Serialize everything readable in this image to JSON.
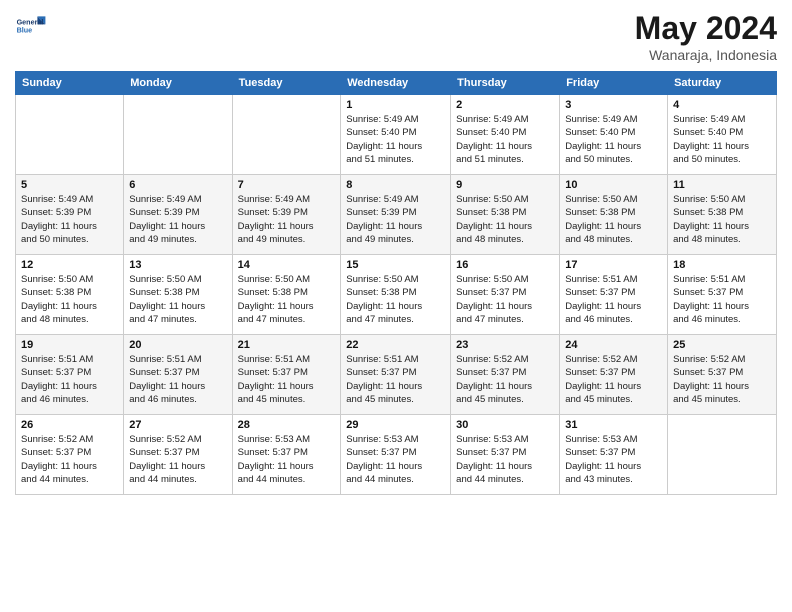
{
  "header": {
    "logo_line1": "General",
    "logo_line2": "Blue",
    "title": "May 2024",
    "location": "Wanaraja, Indonesia"
  },
  "weekdays": [
    "Sunday",
    "Monday",
    "Tuesday",
    "Wednesday",
    "Thursday",
    "Friday",
    "Saturday"
  ],
  "weeks": [
    [
      {
        "day": "",
        "info": ""
      },
      {
        "day": "",
        "info": ""
      },
      {
        "day": "",
        "info": ""
      },
      {
        "day": "1",
        "info": "Sunrise: 5:49 AM\nSunset: 5:40 PM\nDaylight: 11 hours\nand 51 minutes."
      },
      {
        "day": "2",
        "info": "Sunrise: 5:49 AM\nSunset: 5:40 PM\nDaylight: 11 hours\nand 51 minutes."
      },
      {
        "day": "3",
        "info": "Sunrise: 5:49 AM\nSunset: 5:40 PM\nDaylight: 11 hours\nand 50 minutes."
      },
      {
        "day": "4",
        "info": "Sunrise: 5:49 AM\nSunset: 5:40 PM\nDaylight: 11 hours\nand 50 minutes."
      }
    ],
    [
      {
        "day": "5",
        "info": "Sunrise: 5:49 AM\nSunset: 5:39 PM\nDaylight: 11 hours\nand 50 minutes."
      },
      {
        "day": "6",
        "info": "Sunrise: 5:49 AM\nSunset: 5:39 PM\nDaylight: 11 hours\nand 49 minutes."
      },
      {
        "day": "7",
        "info": "Sunrise: 5:49 AM\nSunset: 5:39 PM\nDaylight: 11 hours\nand 49 minutes."
      },
      {
        "day": "8",
        "info": "Sunrise: 5:49 AM\nSunset: 5:39 PM\nDaylight: 11 hours\nand 49 minutes."
      },
      {
        "day": "9",
        "info": "Sunrise: 5:50 AM\nSunset: 5:38 PM\nDaylight: 11 hours\nand 48 minutes."
      },
      {
        "day": "10",
        "info": "Sunrise: 5:50 AM\nSunset: 5:38 PM\nDaylight: 11 hours\nand 48 minutes."
      },
      {
        "day": "11",
        "info": "Sunrise: 5:50 AM\nSunset: 5:38 PM\nDaylight: 11 hours\nand 48 minutes."
      }
    ],
    [
      {
        "day": "12",
        "info": "Sunrise: 5:50 AM\nSunset: 5:38 PM\nDaylight: 11 hours\nand 48 minutes."
      },
      {
        "day": "13",
        "info": "Sunrise: 5:50 AM\nSunset: 5:38 PM\nDaylight: 11 hours\nand 47 minutes."
      },
      {
        "day": "14",
        "info": "Sunrise: 5:50 AM\nSunset: 5:38 PM\nDaylight: 11 hours\nand 47 minutes."
      },
      {
        "day": "15",
        "info": "Sunrise: 5:50 AM\nSunset: 5:38 PM\nDaylight: 11 hours\nand 47 minutes."
      },
      {
        "day": "16",
        "info": "Sunrise: 5:50 AM\nSunset: 5:37 PM\nDaylight: 11 hours\nand 47 minutes."
      },
      {
        "day": "17",
        "info": "Sunrise: 5:51 AM\nSunset: 5:37 PM\nDaylight: 11 hours\nand 46 minutes."
      },
      {
        "day": "18",
        "info": "Sunrise: 5:51 AM\nSunset: 5:37 PM\nDaylight: 11 hours\nand 46 minutes."
      }
    ],
    [
      {
        "day": "19",
        "info": "Sunrise: 5:51 AM\nSunset: 5:37 PM\nDaylight: 11 hours\nand 46 minutes."
      },
      {
        "day": "20",
        "info": "Sunrise: 5:51 AM\nSunset: 5:37 PM\nDaylight: 11 hours\nand 46 minutes."
      },
      {
        "day": "21",
        "info": "Sunrise: 5:51 AM\nSunset: 5:37 PM\nDaylight: 11 hours\nand 45 minutes."
      },
      {
        "day": "22",
        "info": "Sunrise: 5:51 AM\nSunset: 5:37 PM\nDaylight: 11 hours\nand 45 minutes."
      },
      {
        "day": "23",
        "info": "Sunrise: 5:52 AM\nSunset: 5:37 PM\nDaylight: 11 hours\nand 45 minutes."
      },
      {
        "day": "24",
        "info": "Sunrise: 5:52 AM\nSunset: 5:37 PM\nDaylight: 11 hours\nand 45 minutes."
      },
      {
        "day": "25",
        "info": "Sunrise: 5:52 AM\nSunset: 5:37 PM\nDaylight: 11 hours\nand 45 minutes."
      }
    ],
    [
      {
        "day": "26",
        "info": "Sunrise: 5:52 AM\nSunset: 5:37 PM\nDaylight: 11 hours\nand 44 minutes."
      },
      {
        "day": "27",
        "info": "Sunrise: 5:52 AM\nSunset: 5:37 PM\nDaylight: 11 hours\nand 44 minutes."
      },
      {
        "day": "28",
        "info": "Sunrise: 5:53 AM\nSunset: 5:37 PM\nDaylight: 11 hours\nand 44 minutes."
      },
      {
        "day": "29",
        "info": "Sunrise: 5:53 AM\nSunset: 5:37 PM\nDaylight: 11 hours\nand 44 minutes."
      },
      {
        "day": "30",
        "info": "Sunrise: 5:53 AM\nSunset: 5:37 PM\nDaylight: 11 hours\nand 44 minutes."
      },
      {
        "day": "31",
        "info": "Sunrise: 5:53 AM\nSunset: 5:37 PM\nDaylight: 11 hours\nand 43 minutes."
      },
      {
        "day": "",
        "info": ""
      }
    ]
  ]
}
